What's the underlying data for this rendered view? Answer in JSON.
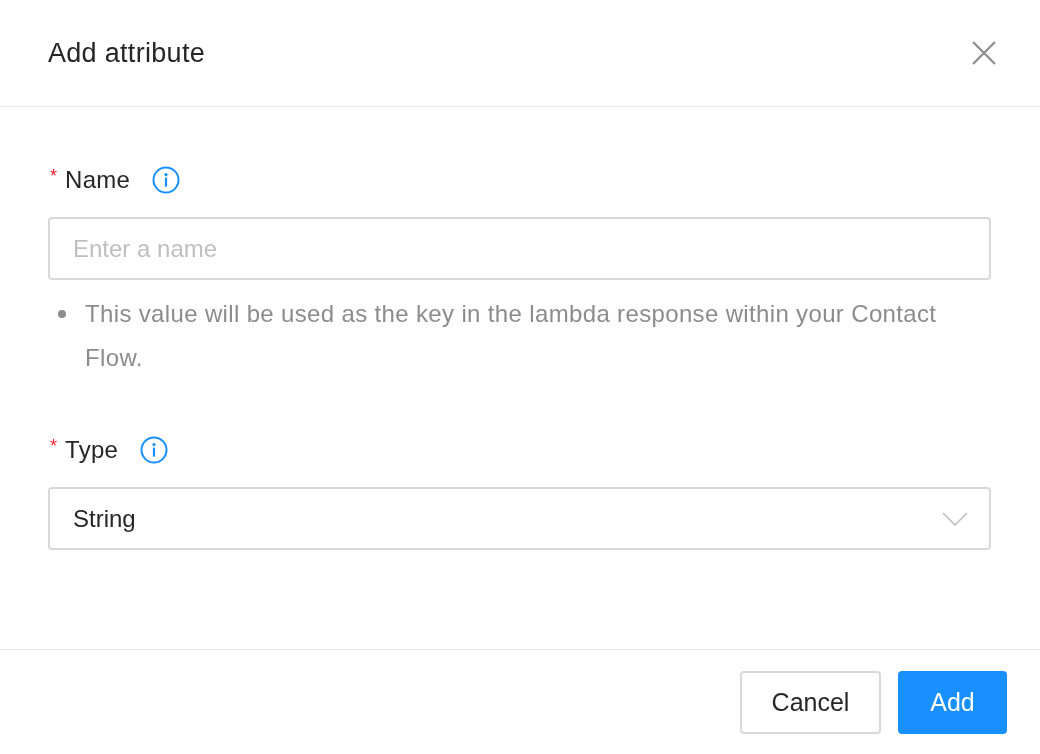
{
  "dialog": {
    "title": "Add attribute"
  },
  "fields": [
    {
      "kind": "text",
      "required_mark": "*",
      "label": "Name",
      "placeholder": "Enter a name",
      "hints": [
        "This value will be used as the key in the lambda response within your Contact Flow."
      ]
    },
    {
      "kind": "select",
      "required_mark": "*",
      "label": "Type",
      "value": "String"
    }
  ],
  "buttons": [
    {
      "kind": "secondary",
      "label": "Cancel"
    },
    {
      "kind": "primary",
      "label": "Add"
    }
  ]
}
